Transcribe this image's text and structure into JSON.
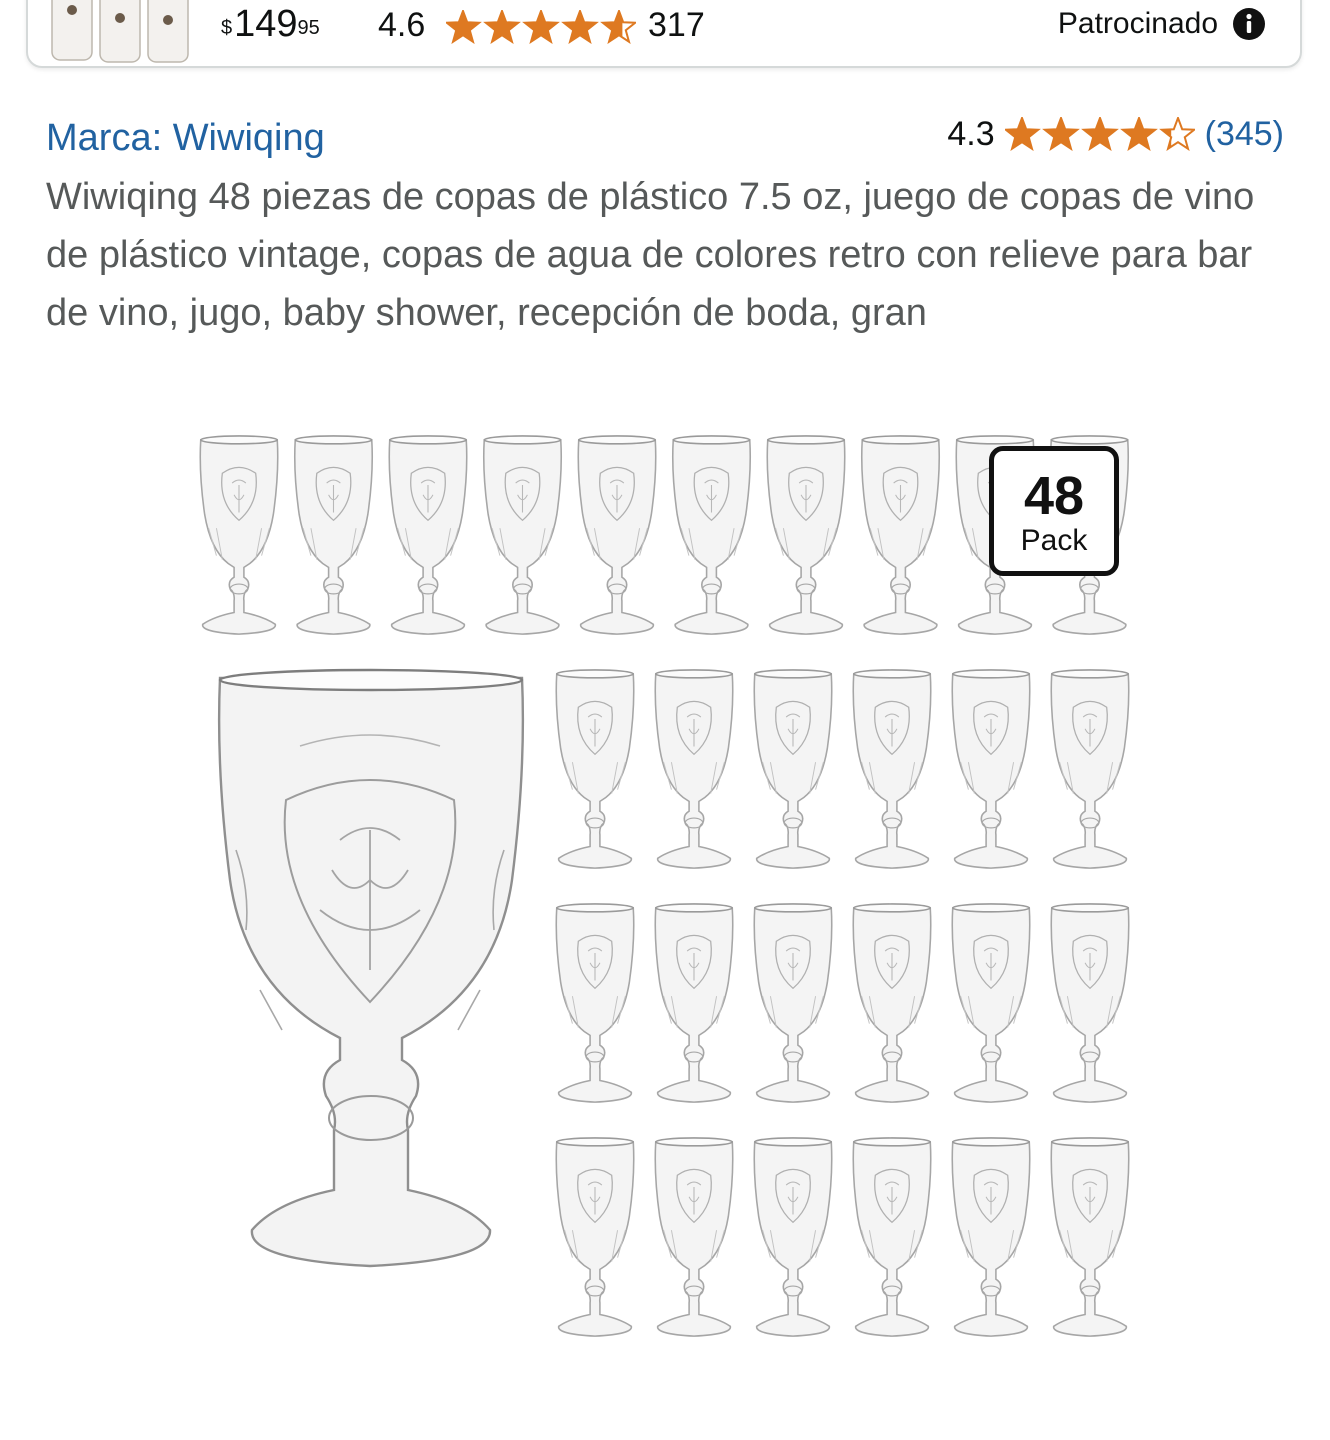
{
  "sponsored_ad": {
    "price_symbol": "$",
    "price_whole": "149",
    "price_cents": "95",
    "rating": "4.6",
    "rating_stars": 4.6,
    "review_count": "317",
    "sponsored_label": "Patrocinado",
    "thumbnail_icon": "ceramic-mugs-thumbnail"
  },
  "product": {
    "brand_label": "Marca: Wiwiqing",
    "rating": "4.3",
    "rating_stars": 4.3,
    "review_count": "(345)",
    "title": "Wiwiqing 48 piezas de copas de plástico 7.5 oz, juego de copas de vino de plástico vintage, copas de agua de colores retro con relieve para bar de vino, jugo, baby shower, recepción de boda, gran"
  },
  "image": {
    "badge_number": "48",
    "badge_label": "Pack"
  },
  "colors": {
    "link": "#2162a1",
    "star": "#de7921",
    "text_secondary": "#565959"
  }
}
